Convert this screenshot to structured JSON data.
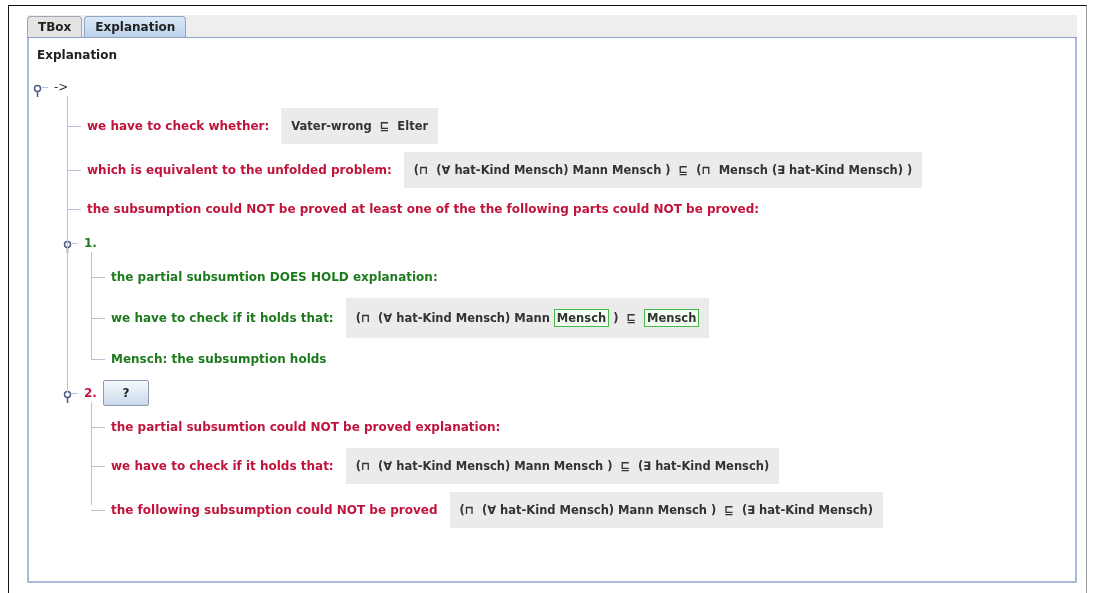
{
  "tabs": [
    {
      "label": "TBox",
      "selected": false
    },
    {
      "label": "Explanation",
      "selected": true
    }
  ],
  "panel_title": "Explanation",
  "tree": {
    "label": "->",
    "color": "#333333",
    "expanded": true,
    "children": [
      {
        "label": "we have to check whether:",
        "color": "#c0143c",
        "formula": [
          {
            "text": "Vater-wrong  ⊑  Elter",
            "highlighted": false
          }
        ]
      },
      {
        "label": "which is equivalent to the unfolded problem:",
        "color": "#c0143c",
        "formula": [
          {
            "text": "(⊓  (∀ hat-Kind Mensch) Mann Mensch )  ⊑  (⊓  Mensch (∃ hat-Kind Mensch) )",
            "highlighted": false
          }
        ]
      },
      {
        "label": "the subsumption could NOT be proved at least one of the the following parts could NOT be proved:",
        "color": "#c0143c"
      },
      {
        "label": "1.",
        "color": "#1e7a1e",
        "expanded": true,
        "children": [
          {
            "label": "the partial subsumtion DOES HOLD explanation:",
            "color": "#1e7a1e"
          },
          {
            "label": "we have to check if it holds that:",
            "color": "#1e7a1e",
            "formula": [
              {
                "text": "(⊓  (∀ hat-Kind Mensch) Mann",
                "highlighted": false
              },
              {
                "text": "Mensch",
                "highlighted": true
              },
              {
                "text": ")  ⊑ ",
                "highlighted": false
              },
              {
                "text": "Mensch",
                "highlighted": true
              }
            ]
          },
          {
            "label": "Mensch: the subsumption holds",
            "color": "#1e7a1e"
          }
        ]
      },
      {
        "label": "2.",
        "color": "#c0143c",
        "button": "?",
        "expanded": true,
        "children": [
          {
            "label": "the partial subsumtion could NOT be proved explanation:",
            "color": "#c0143c"
          },
          {
            "label": "we have to check if it holds that:",
            "color": "#c0143c",
            "formula": [
              {
                "text": "(⊓  (∀ hat-Kind Mensch) Mann Mensch )  ⊑  (∃ hat-Kind Mensch)",
                "highlighted": false
              }
            ]
          },
          {
            "label": "the following subsumption could NOT be proved",
            "color": "#c0143c",
            "formula": [
              {
                "text": "(⊓  (∀ hat-Kind Mensch) Mann Mensch )  ⊑  (∃ hat-Kind Mensch)",
                "highlighted": false
              }
            ]
          }
        ]
      }
    ]
  }
}
